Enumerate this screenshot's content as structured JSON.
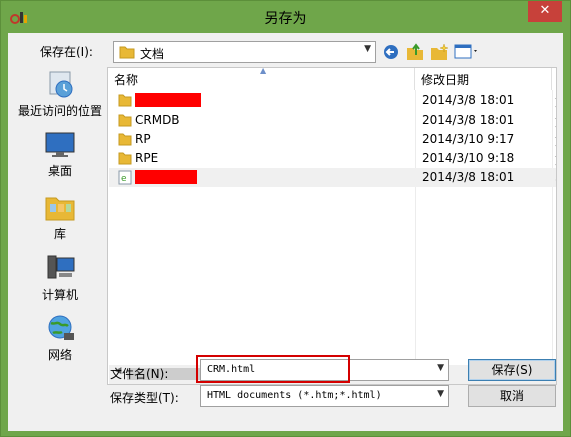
{
  "window": {
    "title": "另存为",
    "close_label": "✕"
  },
  "toolbar": {
    "save_in_label": "保存在(I):",
    "location": "文档"
  },
  "places": [
    {
      "label": "最近访问的位置",
      "icon": "recent-places-icon"
    },
    {
      "label": "桌面",
      "icon": "desktop-icon"
    },
    {
      "label": "库",
      "icon": "libraries-icon"
    },
    {
      "label": "计算机",
      "icon": "computer-icon"
    },
    {
      "label": "网络",
      "icon": "network-icon"
    }
  ],
  "file_list": {
    "columns": {
      "name": "名称",
      "modified": "修改日期"
    },
    "rows": [
      {
        "name": "",
        "date": "2014/3/8 18:01",
        "type": "folder",
        "redacted": true,
        "extra": "文"
      },
      {
        "name": "CRMDB",
        "date": "2014/3/8 18:01",
        "type": "folder",
        "redacted": false,
        "extra": "文"
      },
      {
        "name": "RP",
        "date": "2014/3/10 9:17",
        "type": "folder",
        "redacted": false,
        "extra": "文"
      },
      {
        "name": "RPE",
        "date": "2014/3/10 9:18",
        "type": "folder",
        "redacted": false,
        "extra": "文"
      },
      {
        "name": "",
        "date": "2014/3/8 18:01",
        "type": "html",
        "redacted": true,
        "extra": "3"
      }
    ]
  },
  "form": {
    "filename_label": "文件名(N):",
    "filename_value": "CRM.html",
    "filetype_label": "保存类型(T):",
    "filetype_value": "HTML documents (*.htm;*.html)",
    "save_button": "保存(S)",
    "cancel_button": "取消"
  },
  "colors": {
    "frame": "#6fa64a",
    "close": "#c7413a",
    "redaction": "#ff0000"
  }
}
